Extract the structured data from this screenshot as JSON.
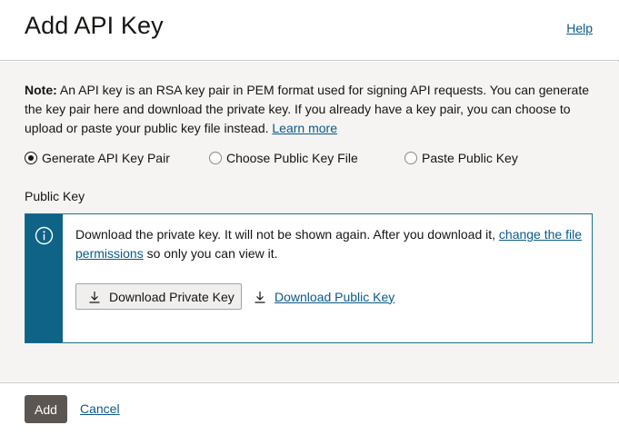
{
  "header": {
    "title": "Add API Key",
    "help_label": "Help"
  },
  "note": {
    "bold": "Note:",
    "text": " An API key is an RSA key pair in PEM format used for signing API requests. You can generate the key pair here and download the private key. If you already have a key pair, you can choose to upload or paste your public key file instead. ",
    "link": "Learn more"
  },
  "options": [
    {
      "label": "Generate API Key Pair",
      "checked": true
    },
    {
      "label": "Choose Public Key File",
      "checked": false
    },
    {
      "label": "Paste Public Key",
      "checked": false
    }
  ],
  "public_key_label": "Public Key",
  "info": {
    "text_before": "Download the private key. It will not be shown again. After you download it, ",
    "link": "change the file permissions",
    "text_after": " so only you can view it.",
    "download_private_label": "Download Private Key",
    "download_public_label": "Download Public Key"
  },
  "footer": {
    "add_label": "Add",
    "cancel_label": "Cancel"
  },
  "colors": {
    "info_stripe": "#0e6387",
    "link": "#0a5a8a",
    "primary_button": "#5b5652"
  },
  "icons": {
    "info": "info-circle-icon",
    "download": "download-icon"
  }
}
